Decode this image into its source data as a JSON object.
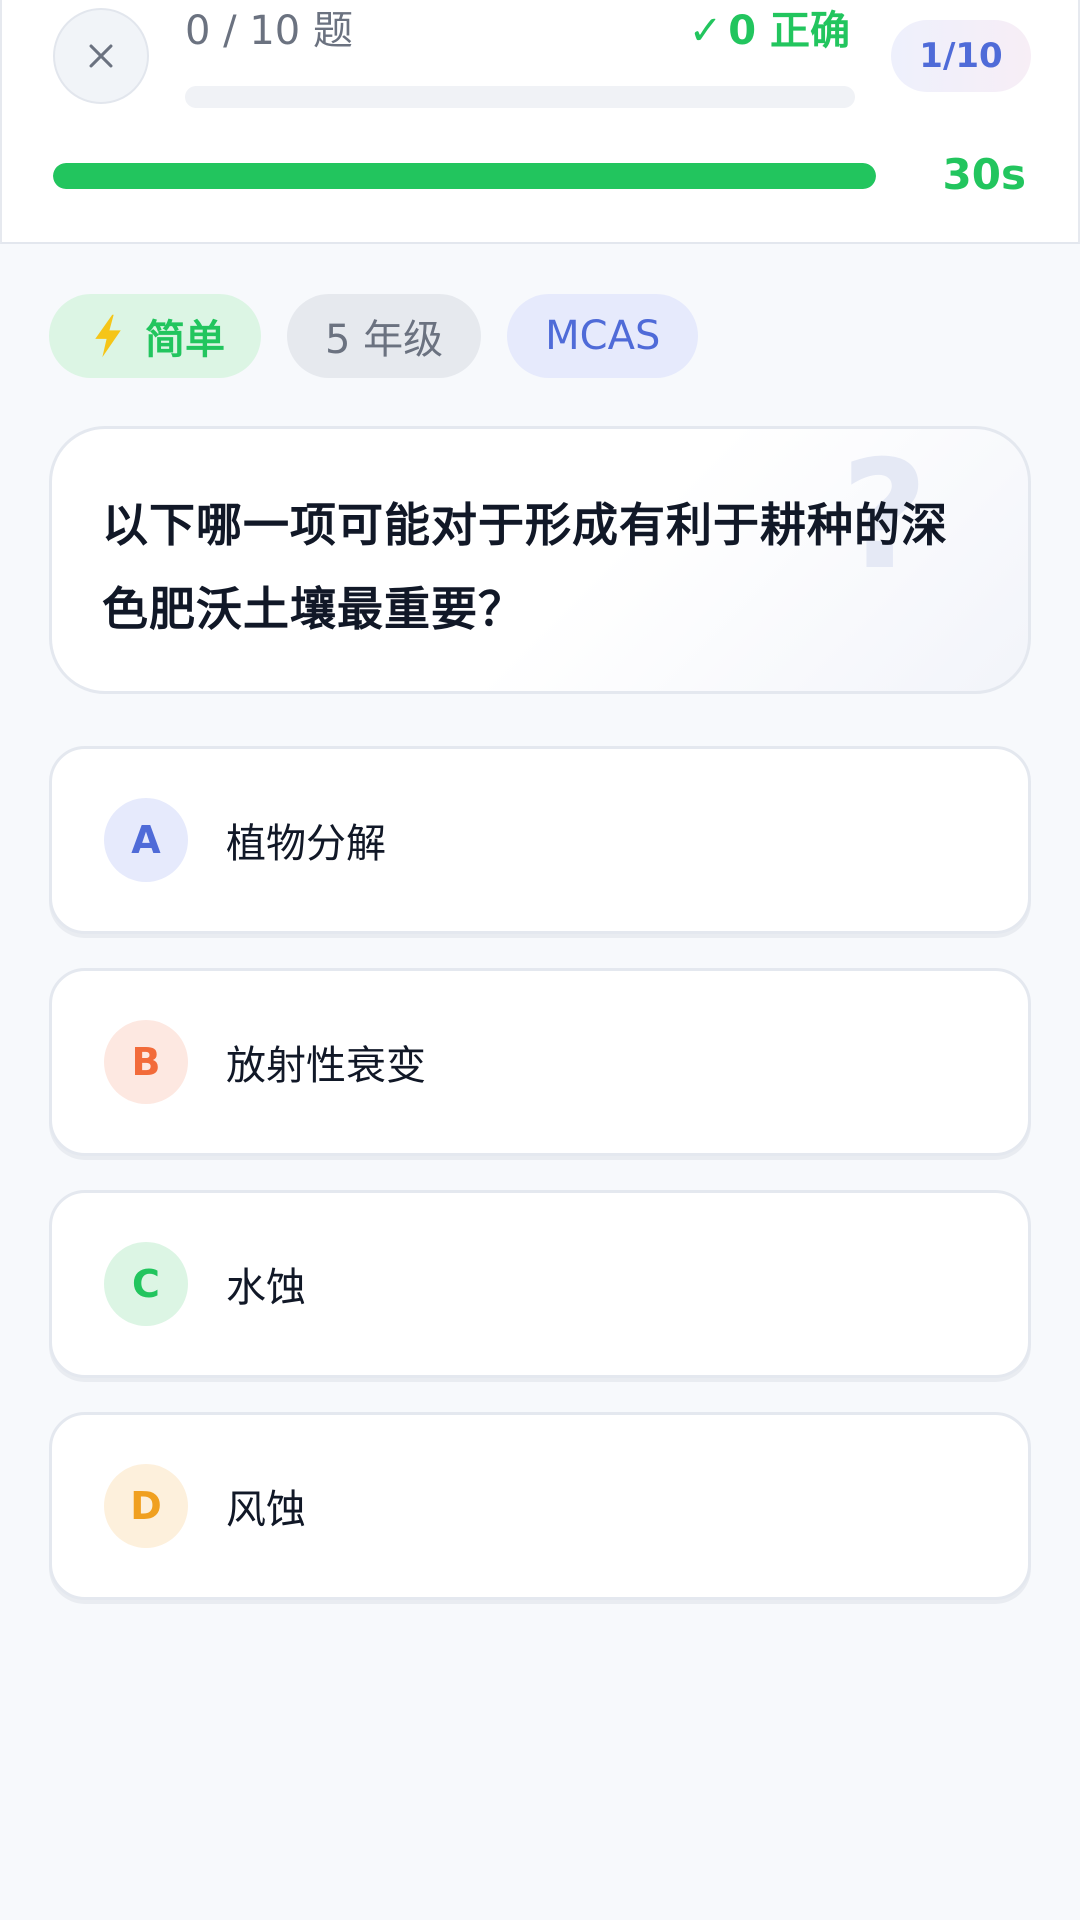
{
  "header": {
    "progress_label": "0 / 10 题",
    "correct_label": "0 正确",
    "correct_icon": "check-icon",
    "answered_fraction": 0.0,
    "question_pill": "1/10",
    "timer_label": "30s",
    "timer_fraction": 1.0
  },
  "tags": {
    "difficulty": "简单",
    "difficulty_icon": "lightning-icon",
    "grade": "5 年级",
    "source": "MCAS"
  },
  "question": {
    "text": "以下哪一项可能对于形成有利于耕种的深色肥沃土壤最重要？",
    "watermark": "?"
  },
  "options": [
    {
      "letter": "A",
      "text": "植物分解"
    },
    {
      "letter": "B",
      "text": "放射性衰变"
    },
    {
      "letter": "C",
      "text": "水蚀"
    },
    {
      "letter": "D",
      "text": "风蚀"
    }
  ],
  "colors": {
    "accent_green": "#22c55e",
    "accent_blue": "#4f6bd8",
    "accent_orange": "#f26b3a",
    "accent_yellow": "#f0a020",
    "background": "#f7f9fc"
  }
}
